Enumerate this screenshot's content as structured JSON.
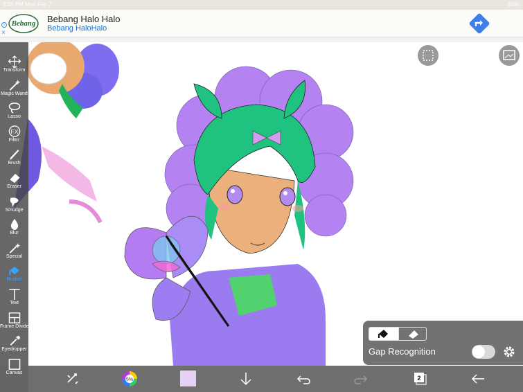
{
  "status_bar": {
    "left": "9:28 PM   Mon Feb 7",
    "right": "82%"
  },
  "ad": {
    "title": "Bebang Halo Halo",
    "subtitle": "Bebang HaloHalo",
    "logo_text": "Bebang",
    "info": "i",
    "close": "×"
  },
  "tools": [
    {
      "name": "transform",
      "label": "Transform",
      "icon": "move-arrows-icon"
    },
    {
      "name": "magic-wand",
      "label": "Magic Wand",
      "icon": "magic-wand-icon"
    },
    {
      "name": "lasso",
      "label": "Lasso",
      "icon": "lasso-icon"
    },
    {
      "name": "filter",
      "label": "Filter",
      "icon": "fx-icon"
    },
    {
      "name": "brush",
      "label": "Brush",
      "icon": "brush-icon"
    },
    {
      "name": "eraser",
      "label": "Eraser",
      "icon": "eraser-icon"
    },
    {
      "name": "smudge",
      "label": "Smudge",
      "icon": "smudge-icon"
    },
    {
      "name": "blur",
      "label": "Blur",
      "icon": "drop-icon"
    },
    {
      "name": "special",
      "label": "Special",
      "icon": "sparkle-wand-icon"
    },
    {
      "name": "bucket",
      "label": "Bucket",
      "icon": "bucket-icon",
      "active": true
    },
    {
      "name": "text",
      "label": "Text",
      "icon": "text-icon"
    },
    {
      "name": "frame-divider",
      "label": "Frame Divider",
      "icon": "frame-divider-icon"
    },
    {
      "name": "eyedropper",
      "label": "Eyedropper",
      "icon": "eyedropper-icon"
    },
    {
      "name": "canvas",
      "label": "Canvas",
      "icon": "canvas-icon"
    }
  ],
  "gap_panel": {
    "label": "Gap Recognition",
    "enabled": false
  },
  "bottom_bar": {
    "color_wheel_text": "5%",
    "current_color": "#e7cff7",
    "layer_count": "2"
  },
  "colors": {
    "toolbar": "#464646",
    "active_tool": "#3aa0ff",
    "hair_green": "#1fc27f",
    "hair_purple": "#b47cf0",
    "skin": "#ebb07c",
    "shirt": "#9a7cf0"
  }
}
